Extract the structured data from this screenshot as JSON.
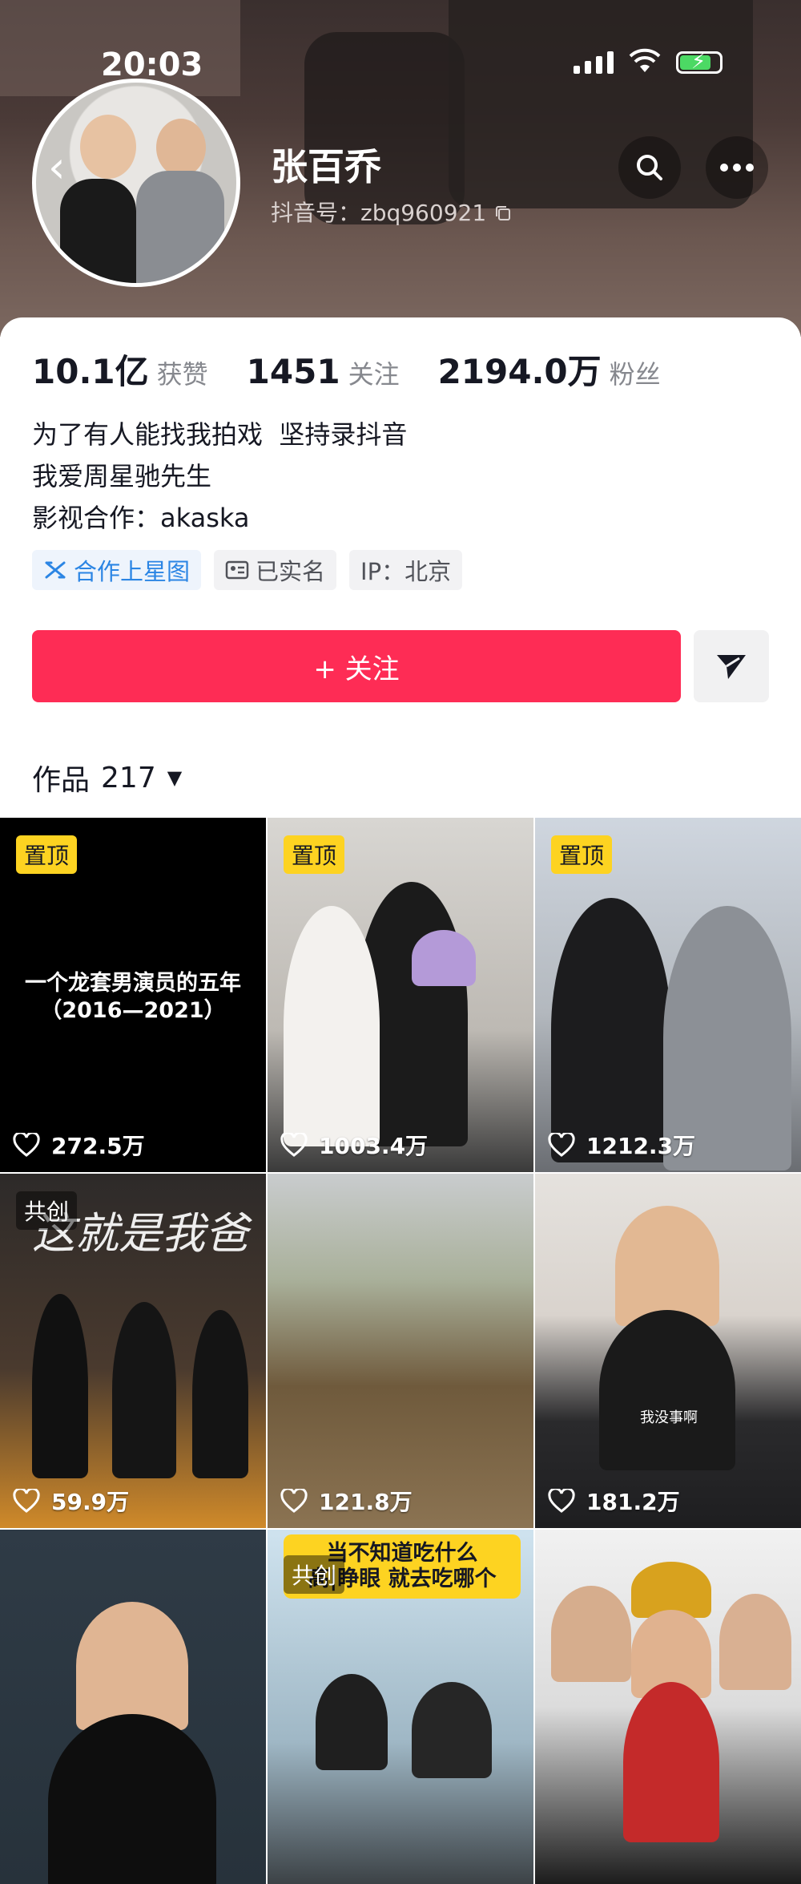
{
  "status_bar": {
    "time": "20:03"
  },
  "profile": {
    "name": "张百乔",
    "douyin_id": "抖音号：zbq960921"
  },
  "stats": [
    {
      "value": "10.1亿",
      "label": "获赞"
    },
    {
      "value": "1451",
      "label": "关注"
    },
    {
      "value": "2194.0万",
      "label": "粉丝"
    }
  ],
  "bio": {
    "line1": "为了有人能找我拍戏  坚持录抖音",
    "line2": "我爱周星驰先生",
    "line3": "影视合作：akaska"
  },
  "tags": [
    {
      "label": "合作上星图",
      "icon": "star-map-icon"
    },
    {
      "label": "已实名",
      "icon": "id-card-icon"
    },
    {
      "label": "IP：北京"
    }
  ],
  "actions": {
    "follow_label": "+ 关注"
  },
  "works": {
    "label": "作品",
    "count": "217"
  },
  "videos": [
    {
      "badge": "置顶",
      "likes": "272.5万",
      "title_line1": "一个龙套男演员的五年",
      "title_line2": "（2016—2021）"
    },
    {
      "badge": "置顶",
      "likes": "1003.4万"
    },
    {
      "badge": "置顶",
      "likes": "1212.3万"
    },
    {
      "badge": "共创",
      "likes": "59.9万",
      "overlay_title": "这就是我爸"
    },
    {
      "likes": "121.8万"
    },
    {
      "likes": "181.2万",
      "subtitle": "我没事啊"
    },
    {},
    {
      "badge": "共创",
      "caption_line1": "当不知道吃什么",
      "caption_line2": "高|睁眼 就去吃哪个"
    },
    {}
  ],
  "colors": {
    "accent": "#fe2c55",
    "pin_badge": "#fdd321",
    "link_blue": "#2b85e4"
  }
}
